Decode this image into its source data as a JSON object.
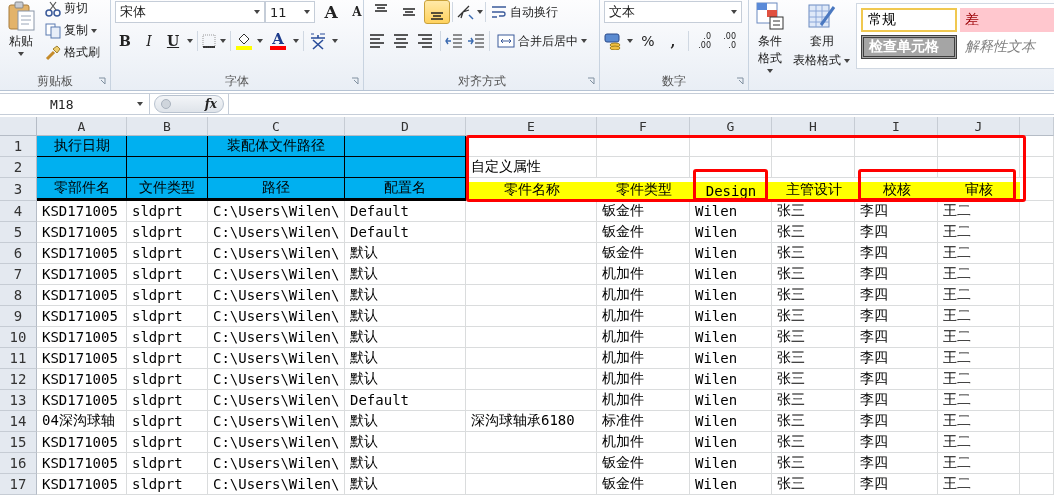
{
  "ribbon": {
    "groups": [
      {
        "kind": "clipboard",
        "label": "剪贴板",
        "paste": "粘贴",
        "items": [
          "剪切",
          "复制",
          "格式刷"
        ]
      },
      {
        "kind": "font",
        "label": "字体",
        "font_name": "宋体",
        "font_size": "11",
        "grow": "A",
        "shrink": "A",
        "bold": "B",
        "italic": "I",
        "underline": "U",
        "font_color": "A"
      },
      {
        "kind": "alignment",
        "label": "对齐方式",
        "vertical_align": [
          {
            "selected": false
          },
          {
            "selected": false
          },
          {
            "selected": true
          }
        ],
        "wrap_text": "自动换行",
        "merge_center": "合并后居中"
      },
      {
        "kind": "number",
        "label": "数字",
        "format": "文本",
        "percent": "%",
        "comma": ",",
        "decimals": [
          [
            ".0",
            ".00"
          ],
          [
            ".00",
            ".0"
          ]
        ]
      },
      {
        "kind": "styles",
        "conditional_format": "条件格式",
        "table_format": [
          "套用",
          "表格格式"
        ],
        "cell_styles": [
          {
            "kind": "normal",
            "text": "常规"
          },
          {
            "kind": "bad",
            "text": "差"
          },
          {
            "kind": "check",
            "text": "检查单元格"
          },
          {
            "kind": "explanatory",
            "text": "解释性文本"
          }
        ]
      }
    ]
  },
  "formula_bar": {
    "name_box": "M18",
    "fx": "fx"
  },
  "sheet": {
    "columns": [
      "A",
      "B",
      "C",
      "D",
      "E",
      "F",
      "G",
      "H",
      "I",
      "J"
    ],
    "rows": [
      {
        "number": "1",
        "framed": true,
        "cells": [
          {
            "text": "执行日期",
            "kind": "blue"
          },
          {
            "kind": "blue"
          },
          {
            "text": "装配体文件路径",
            "kind": "blue"
          },
          {
            "kind": "blue"
          },
          null,
          null,
          null,
          null,
          null,
          null
        ]
      },
      {
        "number": "2",
        "framed": true,
        "cells": [
          {
            "kind": "blue"
          },
          {
            "kind": "blue"
          },
          {
            "kind": "blue"
          },
          {
            "kind": "blue"
          },
          {
            "text": "自定义属性",
            "kind": "plain"
          },
          null,
          null,
          null,
          null,
          null
        ]
      },
      {
        "number": "3",
        "framed": true,
        "cells": [
          {
            "text": "零部件名",
            "kind": "blue"
          },
          {
            "text": "文件类型",
            "kind": "blue"
          },
          {
            "text": "路径",
            "kind": "blue"
          },
          {
            "text": "配置名",
            "kind": "blue"
          },
          {
            "text": "零件名称",
            "kind": "yellow",
            "framed": false
          },
          {
            "text": "零件类型",
            "kind": "yellow",
            "framed": false
          },
          {
            "text": "Design",
            "kind": "yellow",
            "framed": true
          },
          {
            "text": "主管设计",
            "kind": "yellow",
            "framed": false
          },
          {
            "text": "校核",
            "kind": "yellow",
            "framed": true
          },
          {
            "text": "审核",
            "kind": "yellow",
            "framed": true
          }
        ]
      },
      {
        "number": "4",
        "cells": [
          "KSD171005",
          "sldprt",
          "C:\\Users\\Wilen\\",
          "Default",
          null,
          "钣金件",
          "Wilen",
          "张三",
          "李四",
          "王二"
        ]
      },
      {
        "number": "5",
        "cells": [
          "KSD171005",
          "sldprt",
          "C:\\Users\\Wilen\\",
          "Default",
          null,
          "钣金件",
          "Wilen",
          "张三",
          "李四",
          "王二"
        ]
      },
      {
        "number": "6",
        "cells": [
          "KSD171005",
          "sldprt",
          "C:\\Users\\Wilen\\",
          "默认",
          null,
          "钣金件",
          "Wilen",
          "张三",
          "李四",
          "王二"
        ]
      },
      {
        "number": "7",
        "cells": [
          "KSD171005",
          "sldprt",
          "C:\\Users\\Wilen\\",
          "默认",
          null,
          "机加件",
          "Wilen",
          "张三",
          "李四",
          "王二"
        ]
      },
      {
        "number": "8",
        "cells": [
          "KSD171005",
          "sldprt",
          "C:\\Users\\Wilen\\",
          "默认",
          null,
          "机加件",
          "Wilen",
          "张三",
          "李四",
          "王二"
        ]
      },
      {
        "number": "9",
        "cells": [
          "KSD171005",
          "sldprt",
          "C:\\Users\\Wilen\\",
          "默认",
          null,
          "机加件",
          "Wilen",
          "张三",
          "李四",
          "王二"
        ]
      },
      {
        "number": "10",
        "cells": [
          "KSD171005",
          "sldprt",
          "C:\\Users\\Wilen\\",
          "默认",
          null,
          "机加件",
          "Wilen",
          "张三",
          "李四",
          "王二"
        ]
      },
      {
        "number": "11",
        "cells": [
          "KSD171005",
          "sldprt",
          "C:\\Users\\Wilen\\",
          "默认",
          null,
          "机加件",
          "Wilen",
          "张三",
          "李四",
          "王二"
        ]
      },
      {
        "number": "12",
        "cells": [
          "KSD171005",
          "sldprt",
          "C:\\Users\\Wilen\\",
          "默认",
          null,
          "机加件",
          "Wilen",
          "张三",
          "李四",
          "王二"
        ]
      },
      {
        "number": "13",
        "cells": [
          "KSD171005",
          "sldprt",
          "C:\\Users\\Wilen\\",
          "Default",
          null,
          "机加件",
          "Wilen",
          "张三",
          "李四",
          "王二"
        ]
      },
      {
        "number": "14",
        "cells": [
          "04深沟球轴",
          "sldprt",
          "C:\\Users\\Wilen\\",
          "默认",
          "深沟球轴承6180",
          "标准件",
          "Wilen",
          "张三",
          "李四",
          "王二"
        ]
      },
      {
        "number": "15",
        "cells": [
          "KSD171005",
          "sldprt",
          "C:\\Users\\Wilen\\",
          "默认",
          null,
          "机加件",
          "Wilen",
          "张三",
          "李四",
          "王二"
        ]
      },
      {
        "number": "16",
        "cells": [
          "KSD171005",
          "sldprt",
          "C:\\Users\\Wilen\\",
          "默认",
          null,
          "钣金件",
          "Wilen",
          "张三",
          "李四",
          "王二"
        ]
      },
      {
        "number": "17",
        "cells": [
          "KSD171005",
          "sldprt",
          "C:\\Users\\Wilen\\",
          "默认",
          null,
          "钣金件",
          "Wilen",
          "张三",
          "李四",
          "王二"
        ]
      }
    ]
  }
}
